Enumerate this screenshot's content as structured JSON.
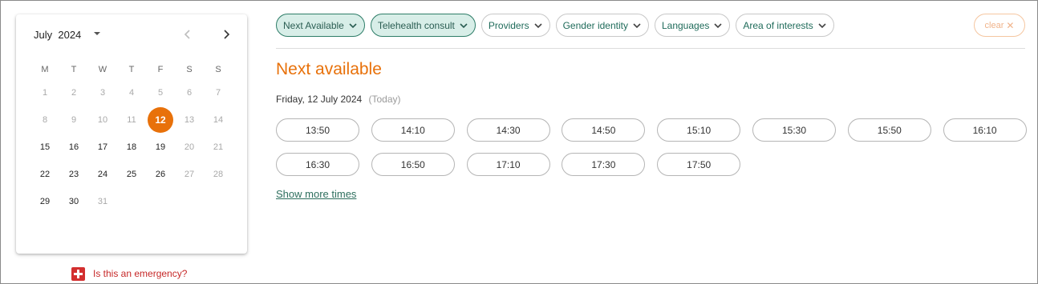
{
  "calendar": {
    "month": "July",
    "year": "2024",
    "weekdays": [
      "M",
      "T",
      "W",
      "T",
      "F",
      "S",
      "S"
    ],
    "weeks": [
      [
        {
          "d": "1",
          "s": "dim"
        },
        {
          "d": "2",
          "s": "dim"
        },
        {
          "d": "3",
          "s": "dim"
        },
        {
          "d": "4",
          "s": "dim"
        },
        {
          "d": "5",
          "s": "dim"
        },
        {
          "d": "6",
          "s": "dim"
        },
        {
          "d": "7",
          "s": "dim"
        }
      ],
      [
        {
          "d": "8",
          "s": "dim"
        },
        {
          "d": "9",
          "s": "dim"
        },
        {
          "d": "10",
          "s": "dim"
        },
        {
          "d": "11",
          "s": "dim"
        },
        {
          "d": "12",
          "s": "sel"
        },
        {
          "d": "13",
          "s": "dim"
        },
        {
          "d": "14",
          "s": "dim"
        }
      ],
      [
        {
          "d": "15",
          "s": "act"
        },
        {
          "d": "16",
          "s": "act"
        },
        {
          "d": "17",
          "s": "act"
        },
        {
          "d": "18",
          "s": "act"
        },
        {
          "d": "19",
          "s": "act"
        },
        {
          "d": "20",
          "s": "dim"
        },
        {
          "d": "21",
          "s": "dim"
        }
      ],
      [
        {
          "d": "22",
          "s": "act"
        },
        {
          "d": "23",
          "s": "act"
        },
        {
          "d": "24",
          "s": "act"
        },
        {
          "d": "25",
          "s": "act"
        },
        {
          "d": "26",
          "s": "act"
        },
        {
          "d": "27",
          "s": "dim"
        },
        {
          "d": "28",
          "s": "dim"
        }
      ],
      [
        {
          "d": "29",
          "s": "act"
        },
        {
          "d": "30",
          "s": "act"
        },
        {
          "d": "31",
          "s": "dim"
        }
      ]
    ]
  },
  "emergency_link": "Is this an emergency?",
  "filters": [
    {
      "label": "Next Available",
      "active": true
    },
    {
      "label": "Telehealth consult",
      "active": true
    },
    {
      "label": "Providers",
      "active": false
    },
    {
      "label": "Gender identity",
      "active": false
    },
    {
      "label": "Languages",
      "active": false
    },
    {
      "label": "Area of interests",
      "active": false
    }
  ],
  "clear_label": "clear",
  "section_title": "Next available",
  "date_text": "Friday, 12 July 2024",
  "today_text": "(Today)",
  "slots": [
    "13:50",
    "14:10",
    "14:30",
    "14:50",
    "15:10",
    "15:30",
    "15:50",
    "16:10",
    "16:30",
    "16:50",
    "17:10",
    "17:30",
    "17:50"
  ],
  "show_more": "Show more times",
  "colors": {
    "accent_orange": "#e8710a",
    "accent_green": "#2e7d68",
    "emergency_red": "#d32f2f"
  }
}
